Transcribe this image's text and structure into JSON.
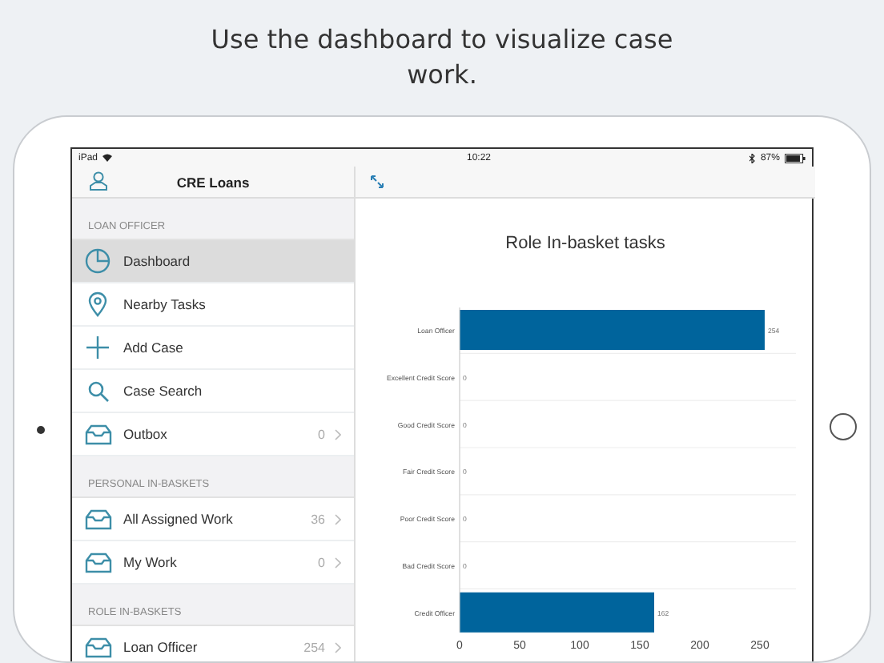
{
  "caption": "Use the dashboard to visualize case work.",
  "status_bar": {
    "device": "iPad",
    "time": "10:22",
    "battery": "87%"
  },
  "sidebar": {
    "title": "CRE Loans",
    "sections": [
      {
        "header": "LOAN OFFICER",
        "items": [
          {
            "kind": "dashboard",
            "label": "Dashboard",
            "selected": true
          },
          {
            "kind": "nearby",
            "label": "Nearby Tasks",
            "selected": false
          },
          {
            "kind": "add",
            "label": "Add Case",
            "selected": false
          },
          {
            "kind": "search",
            "label": "Case Search",
            "selected": false
          },
          {
            "kind": "basket",
            "label": "Outbox",
            "count": "0",
            "selected": false
          }
        ]
      },
      {
        "header": "PERSONAL IN-BASKETS",
        "items": [
          {
            "kind": "basket",
            "label": "All Assigned Work",
            "count": "36",
            "selected": false
          },
          {
            "kind": "basket",
            "label": "My Work",
            "count": "0",
            "selected": false
          }
        ]
      },
      {
        "header": "ROLE IN-BASKETS",
        "items": [
          {
            "kind": "basket",
            "label": "Loan Officer",
            "count": "254",
            "selected": false
          }
        ]
      }
    ]
  },
  "dashboard": {
    "chart_data": {
      "type": "bar",
      "orientation": "horizontal",
      "title": "Role In-basket tasks",
      "categories": [
        "Loan Officer",
        "Excellent Credit Score",
        "Good Credit Score",
        "Fair Credit Score",
        "Poor Credit Score",
        "Bad Credit Score",
        "Credit Officer"
      ],
      "series": [
        {
          "color": "#00649c",
          "values": [
            254,
            0,
            0,
            0,
            0,
            0,
            162
          ]
        }
      ],
      "xlim": [
        0,
        280
      ],
      "xticks": [
        0,
        50,
        100,
        150,
        200,
        250
      ],
      "data_labels": true
    }
  }
}
